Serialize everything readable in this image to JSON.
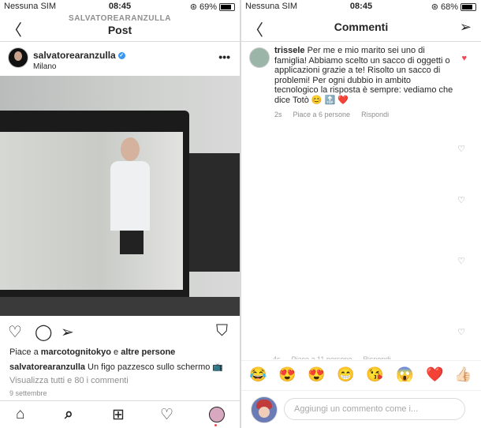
{
  "left": {
    "status": {
      "carrier": "Nessuna SIM",
      "time": "08:45",
      "battery": "69%"
    },
    "nav": {
      "subtitle": "SALVATOREARANZULLA",
      "title": "Post"
    },
    "post": {
      "username": "salvatorearanzulla",
      "location": "Milano",
      "likes_prefix": "Piace a ",
      "likes_user": "marcotognitokyo",
      "likes_mid": " e ",
      "likes_others": "altre persone",
      "caption_user": "salvatorearanzulla",
      "caption_text": " Un figo pazzesco sullo schermo 📺",
      "view_comments": "Visualizza tutti e 80 i commenti",
      "date": "9 settembre"
    },
    "icons": [
      "back-icon",
      "more-icon",
      "heart-icon",
      "comment-icon",
      "share-icon",
      "bookmark-icon",
      "home-icon",
      "search-icon",
      "add-icon",
      "activity-icon",
      "profile-icon"
    ]
  },
  "right": {
    "status": {
      "carrier": "Nessuna SIM",
      "time": "08:45",
      "battery": "68%"
    },
    "nav": {
      "title": "Commenti"
    },
    "comment": {
      "user": "trissele",
      "text": " Per me e mio marito sei uno di famiglia! Abbiamo scelto un sacco di oggetti o applicazioni grazie a te! Risolto un sacco di problemi! Per ogni dubbio in ambito tecnologico la risposta è sempre: vediamo che dice Totò 😊 🔝 ❤️",
      "age": "2s",
      "likes": "Piace a 6 persone",
      "reply": "Rispondi"
    },
    "faded_meta": {
      "age": "4s",
      "likes": "Piace a 11 persone",
      "reply": "Rispondi"
    },
    "emojis": [
      "😂",
      "😍",
      "😍",
      "😁",
      "😘",
      "😱",
      "❤️",
      "👍🏻"
    ],
    "input": {
      "placeholder": "Aggiungi un commento come i..."
    }
  }
}
